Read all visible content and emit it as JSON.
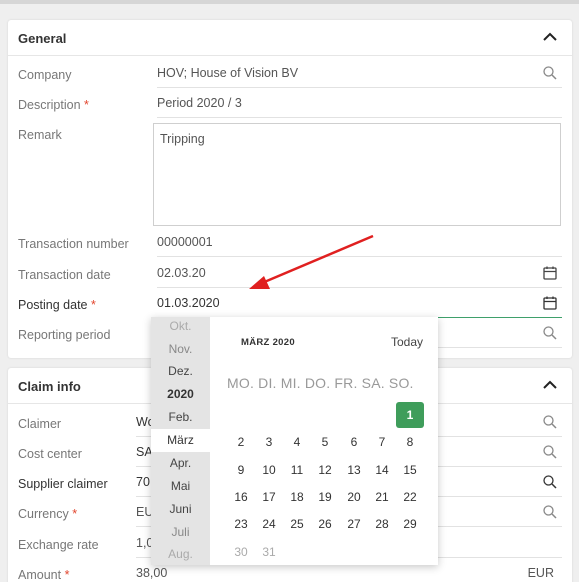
{
  "general": {
    "title": "General",
    "fields": {
      "company": {
        "label": "Company",
        "value": "HOV; House of Vision BV"
      },
      "description": {
        "label": "Description",
        "value": "Period 2020 / 3"
      },
      "remark": {
        "label": "Remark",
        "value": "Tripping"
      },
      "transaction_number": {
        "label": "Transaction number",
        "value": "00000001"
      },
      "transaction_date": {
        "label": "Transaction date",
        "value": "02.03.20"
      },
      "posting_date": {
        "label": "Posting date",
        "value": "01.03.2020"
      },
      "reporting_period": {
        "label": "Reporting period",
        "value": ""
      }
    },
    "required_mark": "*"
  },
  "claim_info": {
    "title": "Claim info",
    "fields": {
      "claimer": {
        "label": "Claimer",
        "value": "Wo"
      },
      "cost_center": {
        "label": "Cost center",
        "value": "SA"
      },
      "supplier_claimer": {
        "label": "Supplier claimer",
        "value": "70"
      },
      "currency": {
        "label": "Currency",
        "value": "EU"
      },
      "exchange_rate": {
        "label": "Exchange rate",
        "value": "1,0"
      },
      "amount": {
        "label": "Amount",
        "value": "38,00",
        "unit": "EUR"
      }
    }
  },
  "date_picker": {
    "months": [
      "Okt.",
      "Nov.",
      "Dez.",
      "2020",
      "Feb.",
      "März",
      "Apr.",
      "Mai",
      "Juni",
      "Juli",
      "Aug."
    ],
    "selected_month": "März",
    "title": "MÄRZ 2020",
    "today_label": "Today",
    "weekdays": "MO. DI. MI. DO. FR. SA. SO.",
    "days": [
      "1",
      "2",
      "3",
      "4",
      "5",
      "6",
      "7",
      "8",
      "9",
      "10",
      "11",
      "12",
      "13",
      "14",
      "15",
      "16",
      "17",
      "18",
      "19",
      "20",
      "21",
      "22",
      "23",
      "24",
      "25",
      "26",
      "27",
      "28",
      "29",
      "30",
      "31"
    ],
    "selected_day": "1"
  },
  "colors": {
    "accent": "#3f9d5b",
    "required": "#e2452d",
    "arrow": "#e02020"
  }
}
